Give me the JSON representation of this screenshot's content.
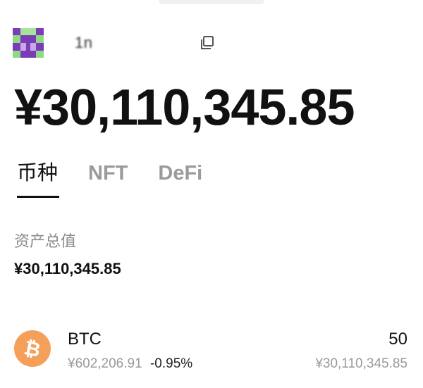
{
  "account": {
    "avatar_colors": {
      "purple": "#7a3db8",
      "green": "#7fd37a",
      "light": "#d9cde8"
    },
    "address_fragment": "1n",
    "copy_icon": "copy-icon"
  },
  "balance": {
    "display": "¥30,110,345.85"
  },
  "tabs": [
    {
      "label": "币种",
      "active": true
    },
    {
      "label": "NFT",
      "active": false
    },
    {
      "label": "DeFi",
      "active": false
    }
  ],
  "summary": {
    "label": "资产总值",
    "value": "¥30,110,345.85"
  },
  "assets": [
    {
      "symbol": "BTC",
      "icon": "bitcoin-icon",
      "icon_color": "#f5a05a",
      "price": "¥602,206.91",
      "change": "-0.95%",
      "quantity": "50",
      "value": "¥30,110,345.85"
    }
  ]
}
